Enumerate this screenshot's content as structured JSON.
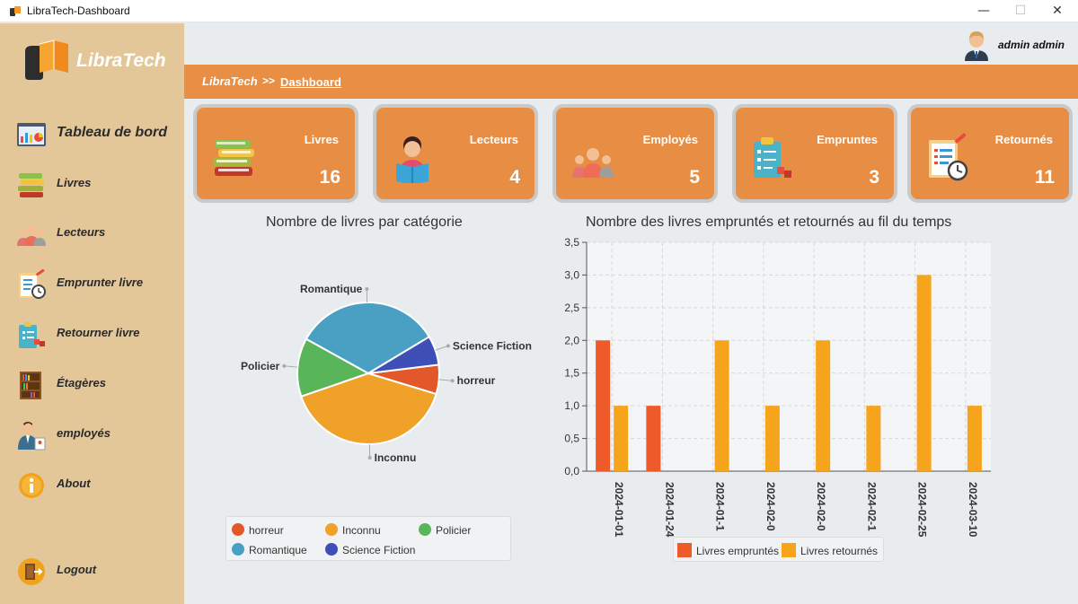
{
  "window": {
    "title": "LibraTech-Dashboard",
    "min_icon": "minimize-glyph",
    "max_icon": "maximize-glyph",
    "close_icon": "close-glyph"
  },
  "brand": {
    "name": "LibraTech",
    "icon": "logo-icon"
  },
  "user": {
    "name": "admin admin",
    "icon": "user-avatar"
  },
  "breadcrumb": {
    "root": "LibraTech",
    "separator": ">>",
    "current": "Dashboard"
  },
  "sidebar": {
    "items": [
      {
        "label": "Tableau de bord",
        "icon": "dashboard-icon",
        "active": true
      },
      {
        "label": "Livres",
        "icon": "books-icon"
      },
      {
        "label": "Lecteurs",
        "icon": "readers-icon"
      },
      {
        "label": "Emprunter livre",
        "icon": "borrow-icon"
      },
      {
        "label": "Retourner livre",
        "icon": "return-icon"
      },
      {
        "label": "Étagères",
        "icon": "shelves-icon"
      },
      {
        "label": "employés",
        "icon": "employee-icon"
      },
      {
        "label": "About",
        "icon": "info-icon"
      },
      {
        "label": "Logout",
        "icon": "logout-icon"
      }
    ]
  },
  "cards": [
    {
      "label": "Livres",
      "value": "16",
      "icon": "books-stack-icon"
    },
    {
      "label": "Lecteurs",
      "value": "4",
      "icon": "reader-icon"
    },
    {
      "label": "Employés",
      "value": "5",
      "icon": "employees-icon"
    },
    {
      "label": "Empruntes",
      "value": "3",
      "icon": "clipboard-borrow-icon"
    },
    {
      "label": "Retournés",
      "value": "11",
      "icon": "clipboard-clock-icon"
    }
  ],
  "colors": {
    "orange": "#e88f45",
    "sidebar": "#e3c798",
    "emprunt": "#ee5a2a",
    "retour": "#f6a41c"
  },
  "chart_data": [
    {
      "type": "pie",
      "title": "Nombre de livres par catégorie",
      "slices": [
        {
          "label": "horreur",
          "value": 1,
          "color": "#e3582b"
        },
        {
          "label": "Inconnu",
          "value": 6,
          "color": "#f0a12a"
        },
        {
          "label": "Policier",
          "value": 2,
          "color": "#58b55a"
        },
        {
          "label": "Romantique",
          "value": 5,
          "color": "#4aa0c3"
        },
        {
          "label": "Science Fiction",
          "value": 1,
          "color": "#3f4fb8"
        }
      ]
    },
    {
      "type": "bar",
      "title": "Nombre des livres empruntés et retournés au fil du temps",
      "categories": [
        "2024-01-01",
        "2024-01-24",
        "2024-01-1",
        "2024-02-0",
        "2024-02-0",
        "2024-02-1",
        "2024-02-25",
        "2024-03-10"
      ],
      "series": [
        {
          "name": "Livres empruntés",
          "values": [
            2,
            1,
            0,
            0,
            0,
            0,
            0,
            0
          ],
          "color": "#ee5a2a"
        },
        {
          "name": "Livres retournés",
          "values": [
            1,
            0,
            2,
            1,
            2,
            1,
            3,
            1
          ],
          "color": "#f6a41c"
        }
      ],
      "ylim": [
        0,
        3.5
      ],
      "yticks": [
        "0,0",
        "0,5",
        "1,0",
        "1,5",
        "2,0",
        "2,5",
        "3,0",
        "3,5"
      ],
      "grid": true,
      "legend": "bottom"
    }
  ]
}
